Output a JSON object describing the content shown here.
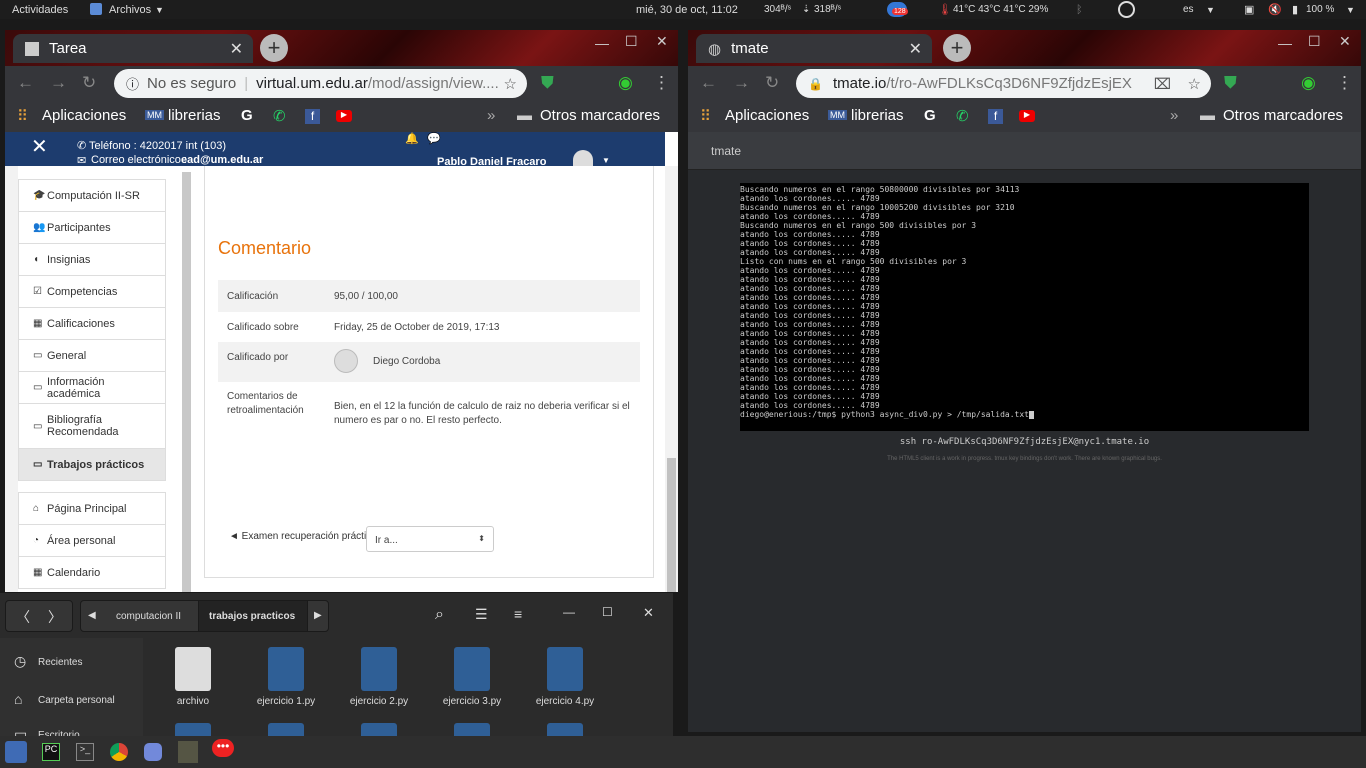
{
  "topbar": {
    "activities": "Actividades",
    "files_app": "Archivos",
    "clock": "mié, 30 de oct, 11:02",
    "net_up": "304ᴮ/ˢ",
    "net_down": "318ᴮ/ˢ",
    "badge": "128",
    "temps": "41°C 43°C 41°C 29%",
    "lang": "es",
    "battery": "100 %"
  },
  "left_window": {
    "tab_title": "Tarea",
    "omnibox_insecure": "No es seguro",
    "omnibox_url_host": "virtual.um.edu.ar",
    "omnibox_url_path": "/mod/assign/view....",
    "bookmarks": {
      "apps": "Aplicaciones",
      "librerias": "librerias",
      "otros": "Otros marcadores"
    }
  },
  "moodle": {
    "phone": "Teléfono : 4202017 int (103)",
    "email_label": "Correo electrónico :",
    "email": "ead@um.edu.ar",
    "user": "Pablo Daniel Fracaro",
    "sidebar": [
      {
        "icon": "graduation-cap-icon",
        "glyph": "🎓",
        "label": "Computación II-SR"
      },
      {
        "icon": "users-icon",
        "glyph": "👥",
        "label": "Participantes"
      },
      {
        "icon": "shield-icon",
        "glyph": "◖",
        "label": "Insignias"
      },
      {
        "icon": "check-square-icon",
        "glyph": "☑",
        "label": "Competencias"
      },
      {
        "icon": "table-icon",
        "glyph": "▦",
        "label": "Calificaciones"
      },
      {
        "icon": "folder-icon",
        "glyph": "▭",
        "label": "General"
      },
      {
        "icon": "folder-icon",
        "glyph": "▭",
        "label": "Información académica"
      },
      {
        "icon": "folder-icon",
        "glyph": "▭",
        "label": "Bibliografía Recomendada"
      },
      {
        "icon": "folder-icon",
        "glyph": "▭",
        "label": "Trabajos prácticos"
      }
    ],
    "sidebar2": [
      {
        "icon": "home-icon",
        "glyph": "⌂",
        "label": "Página Principal"
      },
      {
        "icon": "dashboard-icon",
        "glyph": "◔",
        "label": "Área personal"
      },
      {
        "icon": "calendar-icon",
        "glyph": "▦",
        "label": "Calendario"
      }
    ],
    "section_title": "Comentario",
    "grade_label": "Calificación",
    "grade_value": "95,00 / 100,00",
    "graded_on_label": "Calificado sobre",
    "graded_on_value": "Friday, 25 de October de 2019, 17:13",
    "graded_by_label": "Calificado por",
    "graded_by_value": "Diego Cordoba",
    "feedback_label": "Comentarios de retroalimentación",
    "feedback_value": "Bien, en el 12 la función de calculo de raiz no deberia verificar si el numero es par o no. El resto perfecto.",
    "prev_link": "◄ Examen recuperación prácti",
    "jump_select": "Ir a..."
  },
  "file_manager": {
    "path": [
      "computacion II",
      "trabajos practicos"
    ],
    "places": [
      {
        "icon": "clock-icon",
        "label": "Recientes"
      },
      {
        "icon": "home-icon",
        "label": "Carpeta personal"
      },
      {
        "icon": "desktop-icon",
        "label": "Escritorio"
      }
    ],
    "files": [
      "archivo",
      "ejercicio 1.py",
      "ejercicio 2.py",
      "ejercicio 3.py",
      "ejercicio 4.py"
    ]
  },
  "right_window": {
    "tab_title": "tmate",
    "omnibox_host": "tmate.io",
    "omnibox_path": "/t/ro-AwFDLKsCq3D6NF9ZfjdzEsjEX",
    "bookmarks": {
      "apps": "Aplicaciones",
      "librerias": "librerias",
      "otros": "Otros marcadores"
    },
    "header": "tmate",
    "ssh_line": "ssh ro-AwFDLKsCq3D6NF9ZfjdzEsjEX@nyc1.tmate.io",
    "note": "The HTML5 client is a work in progress. tmux key bindings don't work. There are known graphical bugs."
  },
  "terminal_lines": [
    "Buscando numeros en el rango 50800000 divisibles por 34113",
    "atando los cordones..... 4789",
    "Buscando numeros en el rango 10005200 divisibles por 3210",
    "atando los cordones..... 4789",
    "Buscando numeros en el rango 500 divisibles por 3",
    "atando los cordones..... 4789",
    "atando los cordones..... 4789",
    "atando los cordones..... 4789",
    "Listo con nums en el rango 500 divisibles por 3",
    "atando los cordones..... 4789",
    "atando los cordones..... 4789",
    "atando los cordones..... 4789",
    "atando los cordones..... 4789",
    "atando los cordones..... 4789",
    "atando los cordones..... 4789",
    "atando los cordones..... 4789",
    "atando los cordones..... 4789",
    "atando los cordones..... 4789",
    "atando los cordones..... 4789",
    "atando los cordones..... 4789",
    "atando los cordones..... 4789",
    "atando los cordones..... 4789",
    "atando los cordones..... 4789",
    "atando los cordones..... 4789",
    "atando los cordones..... 4789",
    "diego@enerious:/tmp$ python3 async_div0.py > /tmp/salida.txt"
  ]
}
